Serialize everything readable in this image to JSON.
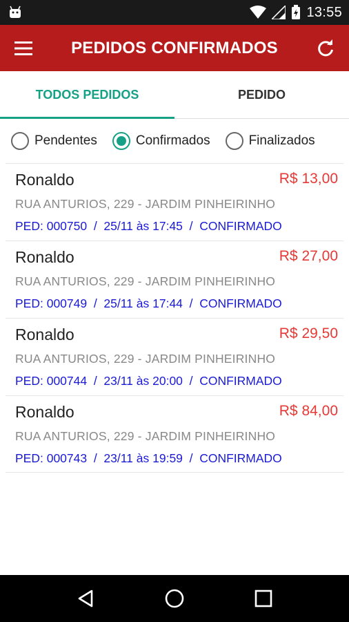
{
  "status_bar": {
    "time": "13:55",
    "icons": [
      "android-icon",
      "wifi-icon",
      "signal-icon",
      "battery-charging-icon"
    ]
  },
  "app_bar": {
    "title": "PEDIDOS CONFIRMADOS",
    "menu_icon": "menu-icon",
    "refresh_icon": "refresh-icon",
    "color": "#b71c1c"
  },
  "tabs": [
    {
      "label": "TODOS PEDIDOS",
      "active": true
    },
    {
      "label": "PEDIDO",
      "active": false
    }
  ],
  "filters": [
    {
      "label": "Pendentes",
      "checked": false
    },
    {
      "label": "Confirmados",
      "checked": true
    },
    {
      "label": "Finalizados",
      "checked": false
    }
  ],
  "accent_color": "#16a085",
  "orders": [
    {
      "name": "Ronaldo",
      "price": "R$ 13,00",
      "address": "RUA ANTURIOS, 229 - JARDIM PINHEIRINHO",
      "meta": "PED: 000750  /  25/11 às 17:45  /  CONFIRMADO"
    },
    {
      "name": "Ronaldo",
      "price": "R$ 27,00",
      "address": "RUA ANTURIOS, 229 - JARDIM PINHEIRINHO",
      "meta": "PED: 000749  /  25/11 às 17:44  /  CONFIRMADO"
    },
    {
      "name": "Ronaldo",
      "price": "R$ 29,50",
      "address": "RUA ANTURIOS, 229 - JARDIM PINHEIRINHO",
      "meta": "PED: 000744  /  23/11 às 20:00  /  CONFIRMADO"
    },
    {
      "name": "Ronaldo",
      "price": "R$ 84,00",
      "address": "RUA ANTURIOS, 229 - JARDIM PINHEIRINHO",
      "meta": "PED: 000743  /  23/11 às 19:59  /  CONFIRMADO"
    }
  ],
  "nav_bar": {
    "icons": [
      "back-icon",
      "home-icon",
      "recents-icon"
    ]
  }
}
